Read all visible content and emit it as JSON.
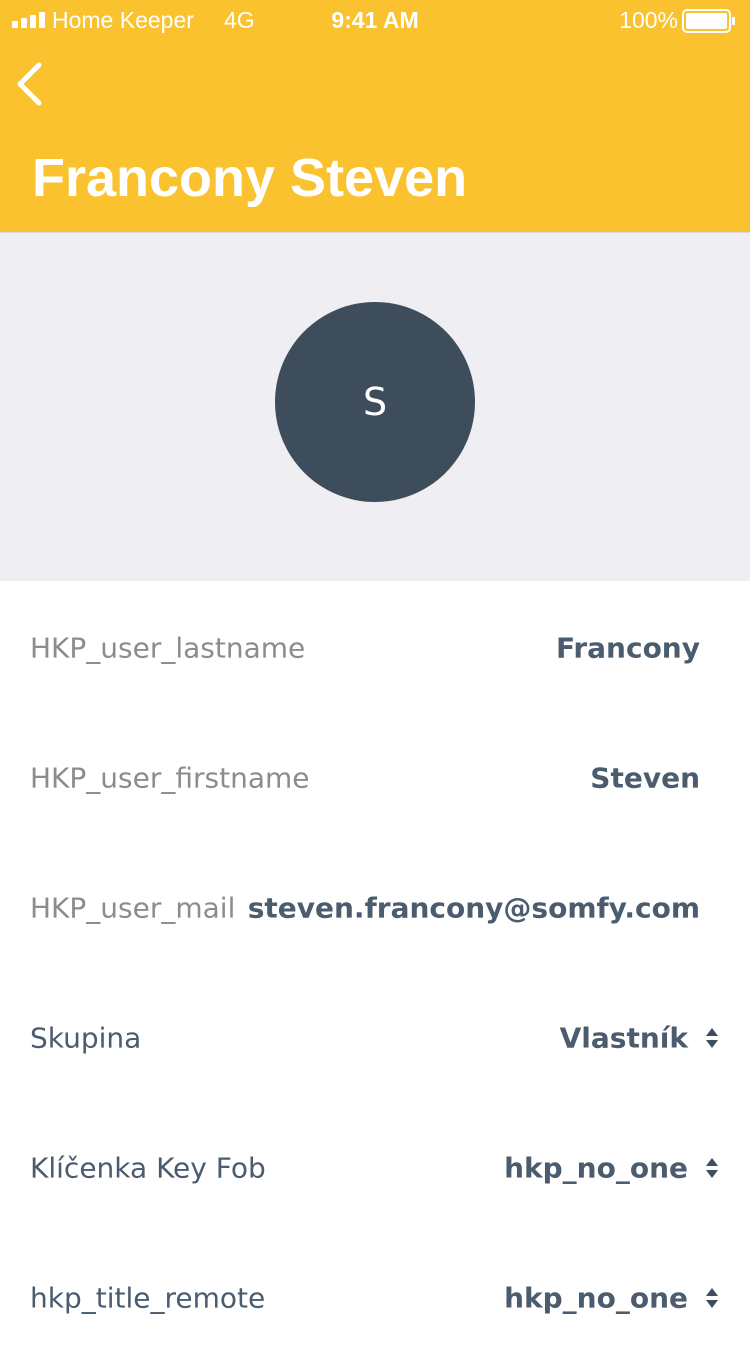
{
  "status_bar": {
    "carrier": "Home Keeper",
    "network": "4G",
    "time": "9:41 AM",
    "battery": "100%"
  },
  "header": {
    "title": "Francony Steven",
    "back_icon": "chevron-left-icon"
  },
  "profile": {
    "avatar_initial": "S"
  },
  "fields": [
    {
      "label": "HKP_user_lastname",
      "value": "Francony"
    },
    {
      "label": "HKP_user_firstname",
      "value": "Steven"
    },
    {
      "label": "HKP_user_mail",
      "value": "steven.francony@somfy.com"
    },
    {
      "label": "Skupina",
      "value": "Vlastník"
    },
    {
      "label": "Klíčenka Key Fob",
      "value": "hkp_no_one"
    },
    {
      "label": "hkp_title_remote",
      "value": "hkp_no_one"
    }
  ],
  "colors": {
    "header": "#FAC22E",
    "avatar": "#3E4D5C",
    "profile_bg": "#EFEEF3",
    "value_text": "#4A5C6E",
    "muted_label": "#8c8c8c"
  }
}
